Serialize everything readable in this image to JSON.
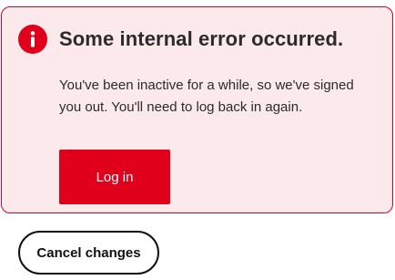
{
  "error": {
    "icon": "alert-circle-icon",
    "title": "Some internal error occurred.",
    "message": "You've been inactive for a while, so we've signed you out. You'll need to log back in again."
  },
  "actions": {
    "login_label": "Log in",
    "cancel_label": "Cancel changes"
  },
  "colors": {
    "brand_red": "#e0001b",
    "panel_background": "#fce9ec",
    "text": "#2b2b2b"
  }
}
